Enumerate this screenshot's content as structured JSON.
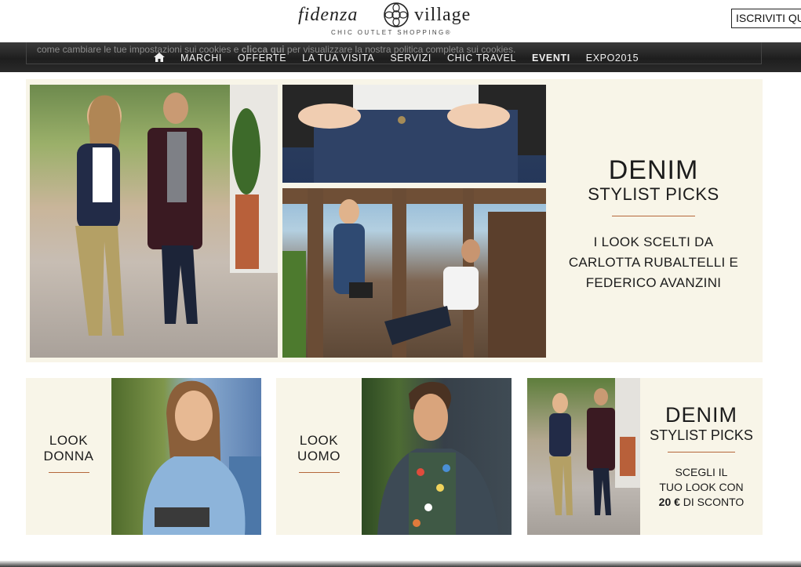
{
  "header": {
    "logo_left": "fidenza",
    "logo_right": "village",
    "tagline": "CHIC OUTLET SHOPPING®",
    "subscribe_label": "ISCRIVITI QU"
  },
  "cookie_notice": {
    "text_start": "come cambiare le tue impostazioni sui cookies e ",
    "link": "clicca qui",
    "text_end": " per visualizzare la nostra politica completa sui cookies."
  },
  "nav": {
    "items": [
      {
        "label": "MARCHI"
      },
      {
        "label": "OFFERTE"
      },
      {
        "label": "LA TUA VISITA"
      },
      {
        "label": "SERVIZI"
      },
      {
        "label": "CHIC TRAVEL"
      },
      {
        "label": "EVENTI",
        "active": true
      },
      {
        "label": "EXPO2015"
      }
    ]
  },
  "hero": {
    "title": "DENIM",
    "subtitle": "STYLIST PICKS",
    "desc_line1": "I LOOK SCELTI DA",
    "desc_line2": "CARLOTTA RUBALTELLI E",
    "desc_line3": "FEDERICO AVANZINI"
  },
  "cards": {
    "donna": {
      "line1": "LOOK",
      "line2": "DONNA"
    },
    "uomo": {
      "line1": "LOOK",
      "line2": "UOMO"
    },
    "denim": {
      "title": "DENIM",
      "subtitle": "STYLIST PICKS",
      "line1": "SCEGLI IL",
      "line2": "TUO LOOK CON",
      "price": "20 €",
      "line3_end": " DI SCONTO"
    }
  },
  "colors": {
    "panel_bg": "#f8f5e8",
    "accent_rule": "#b5673b",
    "nav_bg": "#252525"
  }
}
